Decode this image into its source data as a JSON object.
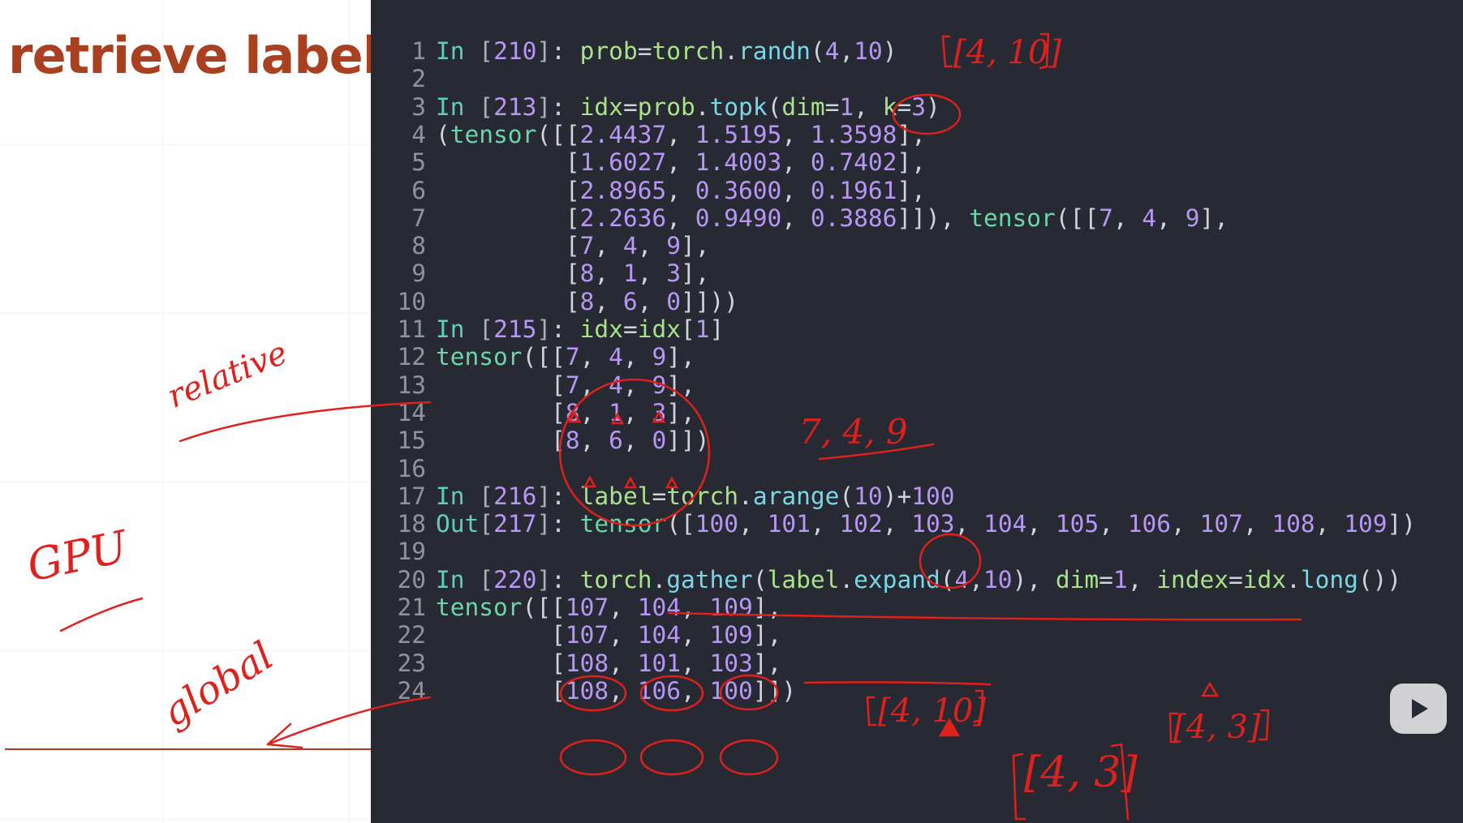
{
  "slide": {
    "title": "retrieve label",
    "notes": [
      "relative",
      "GPU",
      "global"
    ]
  },
  "annotations": [
    "[4, 10]",
    "7, 4, 9",
    "[4, 10]",
    "[4, 3]",
    "[4, 3]"
  ],
  "editor": {
    "lines": [
      {
        "n": "1",
        "tokens": [
          [
            "prompt",
            "In "
          ],
          [
            "bracket",
            "["
          ],
          [
            "num",
            "210"
          ],
          [
            "bracket",
            "]"
          ],
          [
            "text",
            ": "
          ],
          [
            "var",
            "prob"
          ],
          [
            "op",
            "="
          ],
          [
            "var",
            "torch"
          ],
          [
            "op",
            "."
          ],
          [
            "fn",
            "randn"
          ],
          [
            "op",
            "("
          ],
          [
            "num",
            "4"
          ],
          [
            "op",
            ","
          ],
          [
            "num",
            "10"
          ],
          [
            "op",
            ")"
          ]
        ]
      },
      {
        "n": "2",
        "tokens": []
      },
      {
        "n": "3",
        "tokens": [
          [
            "prompt",
            "In "
          ],
          [
            "bracket",
            "["
          ],
          [
            "num",
            "213"
          ],
          [
            "bracket",
            "]"
          ],
          [
            "text",
            ": "
          ],
          [
            "var",
            "idx"
          ],
          [
            "op",
            "="
          ],
          [
            "var",
            "prob"
          ],
          [
            "op",
            "."
          ],
          [
            "fn",
            "topk"
          ],
          [
            "op",
            "("
          ],
          [
            "var",
            "dim"
          ],
          [
            "op",
            "="
          ],
          [
            "num",
            "1"
          ],
          [
            "op",
            ", "
          ],
          [
            "var",
            "k"
          ],
          [
            "op",
            "="
          ],
          [
            "num",
            "3"
          ],
          [
            "op",
            ")"
          ]
        ]
      },
      {
        "n": "4",
        "tokens": [
          [
            "op",
            "("
          ],
          [
            "tensor",
            "tensor"
          ],
          [
            "op",
            "([["
          ],
          [
            "num",
            "2.4437"
          ],
          [
            "op",
            ", "
          ],
          [
            "num",
            "1.5195"
          ],
          [
            "op",
            ", "
          ],
          [
            "num",
            "1.3598"
          ],
          [
            "op",
            "],"
          ]
        ]
      },
      {
        "n": "5",
        "tokens": [
          [
            "op",
            "         ["
          ],
          [
            "num",
            "1.6027"
          ],
          [
            "op",
            ", "
          ],
          [
            "num",
            "1.4003"
          ],
          [
            "op",
            ", "
          ],
          [
            "num",
            "0.7402"
          ],
          [
            "op",
            "],"
          ]
        ]
      },
      {
        "n": "6",
        "tokens": [
          [
            "op",
            "         ["
          ],
          [
            "num",
            "2.8965"
          ],
          [
            "op",
            ", "
          ],
          [
            "num",
            "0.3600"
          ],
          [
            "op",
            ", "
          ],
          [
            "num",
            "0.1961"
          ],
          [
            "op",
            "],"
          ]
        ]
      },
      {
        "n": "7",
        "tokens": [
          [
            "op",
            "         ["
          ],
          [
            "num",
            "2.2636"
          ],
          [
            "op",
            ", "
          ],
          [
            "num",
            "0.9490"
          ],
          [
            "op",
            ", "
          ],
          [
            "num",
            "0.3886"
          ],
          [
            "op",
            "]]), "
          ],
          [
            "tensor",
            "tensor"
          ],
          [
            "op",
            "([["
          ],
          [
            "num",
            "7"
          ],
          [
            "op",
            ", "
          ],
          [
            "num",
            "4"
          ],
          [
            "op",
            ", "
          ],
          [
            "num",
            "9"
          ],
          [
            "op",
            "],"
          ]
        ]
      },
      {
        "n": "8",
        "tokens": [
          [
            "op",
            "         ["
          ],
          [
            "num",
            "7"
          ],
          [
            "op",
            ", "
          ],
          [
            "num",
            "4"
          ],
          [
            "op",
            ", "
          ],
          [
            "num",
            "9"
          ],
          [
            "op",
            "],"
          ]
        ]
      },
      {
        "n": "9",
        "tokens": [
          [
            "op",
            "         ["
          ],
          [
            "num",
            "8"
          ],
          [
            "op",
            ", "
          ],
          [
            "num",
            "1"
          ],
          [
            "op",
            ", "
          ],
          [
            "num",
            "3"
          ],
          [
            "op",
            "],"
          ]
        ]
      },
      {
        "n": "10",
        "tokens": [
          [
            "op",
            "         ["
          ],
          [
            "num",
            "8"
          ],
          [
            "op",
            ", "
          ],
          [
            "num",
            "6"
          ],
          [
            "op",
            ", "
          ],
          [
            "num",
            "0"
          ],
          [
            "op",
            "]]))"
          ]
        ]
      },
      {
        "n": "11",
        "tokens": [
          [
            "prompt",
            "In "
          ],
          [
            "bracket",
            "["
          ],
          [
            "num",
            "215"
          ],
          [
            "bracket",
            "]"
          ],
          [
            "text",
            ": "
          ],
          [
            "var",
            "idx"
          ],
          [
            "op",
            "="
          ],
          [
            "var",
            "idx"
          ],
          [
            "op",
            "["
          ],
          [
            "num",
            "1"
          ],
          [
            "op",
            "]"
          ]
        ]
      },
      {
        "n": "12",
        "tokens": [
          [
            "tensor",
            "tensor"
          ],
          [
            "op",
            "([["
          ],
          [
            "num",
            "7"
          ],
          [
            "op",
            ", "
          ],
          [
            "num",
            "4"
          ],
          [
            "op",
            ", "
          ],
          [
            "num",
            "9"
          ],
          [
            "op",
            "],"
          ]
        ]
      },
      {
        "n": "13",
        "tokens": [
          [
            "op",
            "        ["
          ],
          [
            "num",
            "7"
          ],
          [
            "op",
            ", "
          ],
          [
            "num",
            "4"
          ],
          [
            "op",
            ", "
          ],
          [
            "num",
            "9"
          ],
          [
            "op",
            "],"
          ]
        ]
      },
      {
        "n": "14",
        "tokens": [
          [
            "op",
            "        ["
          ],
          [
            "num",
            "8"
          ],
          [
            "op",
            ", "
          ],
          [
            "num",
            "1"
          ],
          [
            "op",
            ", "
          ],
          [
            "num",
            "3"
          ],
          [
            "op",
            "],"
          ]
        ]
      },
      {
        "n": "15",
        "tokens": [
          [
            "op",
            "        ["
          ],
          [
            "num",
            "8"
          ],
          [
            "op",
            ", "
          ],
          [
            "num",
            "6"
          ],
          [
            "op",
            ", "
          ],
          [
            "num",
            "0"
          ],
          [
            "op",
            "]])"
          ]
        ]
      },
      {
        "n": "16",
        "tokens": []
      },
      {
        "n": "17",
        "tokens": [
          [
            "prompt",
            "In "
          ],
          [
            "bracket",
            "["
          ],
          [
            "num",
            "216"
          ],
          [
            "bracket",
            "]"
          ],
          [
            "text",
            ": "
          ],
          [
            "var",
            "label"
          ],
          [
            "op",
            "="
          ],
          [
            "var",
            "torch"
          ],
          [
            "op",
            "."
          ],
          [
            "fn",
            "arange"
          ],
          [
            "op",
            "("
          ],
          [
            "num",
            "10"
          ],
          [
            "op",
            ")+"
          ],
          [
            "num",
            "100"
          ]
        ]
      },
      {
        "n": "18",
        "tokens": [
          [
            "prompt",
            "Out"
          ],
          [
            "bracket",
            "["
          ],
          [
            "num",
            "217"
          ],
          [
            "bracket",
            "]"
          ],
          [
            "text",
            ": "
          ],
          [
            "tensor",
            "tensor"
          ],
          [
            "op",
            "(["
          ],
          [
            "num",
            "100"
          ],
          [
            "op",
            ", "
          ],
          [
            "num",
            "101"
          ],
          [
            "op",
            ", "
          ],
          [
            "num",
            "102"
          ],
          [
            "op",
            ", "
          ],
          [
            "num",
            "103"
          ],
          [
            "op",
            ", "
          ],
          [
            "num",
            "104"
          ],
          [
            "op",
            ", "
          ],
          [
            "num",
            "105"
          ],
          [
            "op",
            ", "
          ],
          [
            "num",
            "106"
          ],
          [
            "op",
            ", "
          ],
          [
            "num",
            "107"
          ],
          [
            "op",
            ", "
          ],
          [
            "num",
            "108"
          ],
          [
            "op",
            ", "
          ],
          [
            "num",
            "109"
          ],
          [
            "op",
            "])"
          ]
        ]
      },
      {
        "n": "19",
        "tokens": []
      },
      {
        "n": "20",
        "tokens": [
          [
            "prompt",
            "In "
          ],
          [
            "bracket",
            "["
          ],
          [
            "num",
            "220"
          ],
          [
            "bracket",
            "]"
          ],
          [
            "text",
            ": "
          ],
          [
            "var",
            "torch"
          ],
          [
            "op",
            "."
          ],
          [
            "fn",
            "gather"
          ],
          [
            "op",
            "("
          ],
          [
            "var",
            "label"
          ],
          [
            "op",
            "."
          ],
          [
            "fn",
            "expand"
          ],
          [
            "op",
            "("
          ],
          [
            "num",
            "4"
          ],
          [
            "op",
            ","
          ],
          [
            "num",
            "10"
          ],
          [
            "op",
            "), "
          ],
          [
            "var",
            "dim"
          ],
          [
            "op",
            "="
          ],
          [
            "num",
            "1"
          ],
          [
            "op",
            ", "
          ],
          [
            "var",
            "index"
          ],
          [
            "op",
            "="
          ],
          [
            "var",
            "idx"
          ],
          [
            "op",
            "."
          ],
          [
            "fn",
            "long"
          ],
          [
            "op",
            "())"
          ]
        ]
      },
      {
        "n": "21",
        "tokens": [
          [
            "tensor",
            "tensor"
          ],
          [
            "op",
            "([["
          ],
          [
            "num",
            "107"
          ],
          [
            "op",
            ", "
          ],
          [
            "num",
            "104"
          ],
          [
            "op",
            ", "
          ],
          [
            "num",
            "109"
          ],
          [
            "op",
            "],"
          ]
        ]
      },
      {
        "n": "22",
        "tokens": [
          [
            "op",
            "        ["
          ],
          [
            "num",
            "107"
          ],
          [
            "op",
            ", "
          ],
          [
            "num",
            "104"
          ],
          [
            "op",
            ", "
          ],
          [
            "num",
            "109"
          ],
          [
            "op",
            "],"
          ]
        ]
      },
      {
        "n": "23",
        "tokens": [
          [
            "op",
            "        ["
          ],
          [
            "num",
            "108"
          ],
          [
            "op",
            ", "
          ],
          [
            "num",
            "101"
          ],
          [
            "op",
            ", "
          ],
          [
            "num",
            "103"
          ],
          [
            "op",
            "],"
          ]
        ]
      },
      {
        "n": "24",
        "tokens": [
          [
            "op",
            "        ["
          ],
          [
            "num",
            "108"
          ],
          [
            "op",
            ", "
          ],
          [
            "num",
            "106"
          ],
          [
            "op",
            ", "
          ],
          [
            "num",
            "100"
          ],
          [
            "op",
            "]])"
          ]
        ]
      }
    ]
  },
  "colors": {
    "editor_bg": "#272a32",
    "title": "#a9401f",
    "annotation_red": "#e0201c"
  },
  "icons": {
    "player": "play-icon"
  }
}
